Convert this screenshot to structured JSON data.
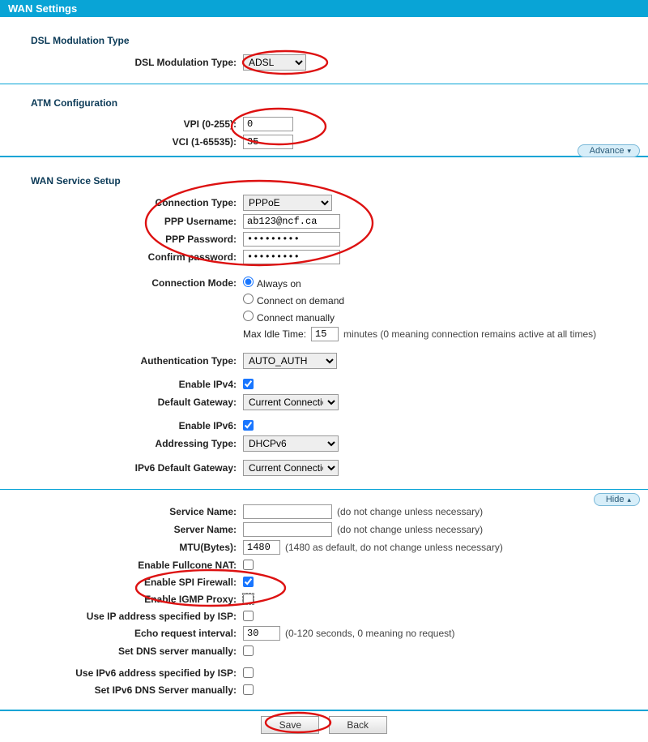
{
  "page": {
    "title": "WAN Settings"
  },
  "dsl": {
    "heading": "DSL Modulation Type",
    "label": "DSL Modulation Type:",
    "value": "ADSL"
  },
  "atm": {
    "heading": "ATM Configuration",
    "vpi_label": "VPI (0-255):",
    "vpi_value": "0",
    "vci_label": "VCI (1-65535):",
    "vci_value": "35",
    "advance_label": "Advance"
  },
  "wan": {
    "heading": "WAN Service Setup",
    "conn_type_label": "Connection Type:",
    "conn_type_value": "PPPoE",
    "ppp_user_label": "PPP Username:",
    "ppp_user_value": "ab123@ncf.ca",
    "ppp_pass_label": "PPP Password:",
    "ppp_pass_value": "•••••••••",
    "ppp_confirm_label": "Confirm password:",
    "ppp_confirm_value": "•••••••••",
    "conn_mode_label": "Connection Mode:",
    "conn_mode_options": {
      "always": "Always on",
      "demand": "Connect on demand",
      "manual": "Connect manually"
    },
    "max_idle_prefix": "Max Idle Time:",
    "max_idle_value": "15",
    "max_idle_suffix": "minutes (0 meaning connection remains active at all times)",
    "auth_type_label": "Authentication Type:",
    "auth_type_value": "AUTO_AUTH",
    "enable_ipv4_label": "Enable IPv4:",
    "default_gw_label": "Default Gateway:",
    "default_gw_value": "Current Connection",
    "enable_ipv6_label": "Enable IPv6:",
    "addr_type_label": "Addressing Type:",
    "addr_type_value": "DHCPv6",
    "ipv6_gw_label": "IPv6 Default Gateway:",
    "ipv6_gw_value": "Current Connection"
  },
  "advanced": {
    "hide_label": "Hide",
    "service_name_label": "Service Name:",
    "service_name_value": "",
    "service_name_note": "(do not change unless necessary)",
    "server_name_label": "Server Name:",
    "server_name_value": "",
    "server_name_note": "(do not change unless necessary)",
    "mtu_label": "MTU(Bytes):",
    "mtu_value": "1480",
    "mtu_note": "(1480 as default, do not change unless necessary)",
    "fullcone_label": "Enable Fullcone NAT:",
    "spi_label": "Enable SPI Firewall:",
    "igmp_label": "Enable IGMP Proxy:",
    "ip_by_isp_label": "Use IP address specified by ISP:",
    "echo_label": "Echo request interval:",
    "echo_value": "30",
    "echo_note": "(0-120 seconds, 0 meaning no request)",
    "dns_manual_label": "Set DNS server manually:",
    "ipv6_by_isp_label": "Use IPv6 address specified by ISP:",
    "ipv6_dns_manual_label": "Set IPv6 DNS Server manually:"
  },
  "buttons": {
    "save": "Save",
    "back": "Back"
  }
}
